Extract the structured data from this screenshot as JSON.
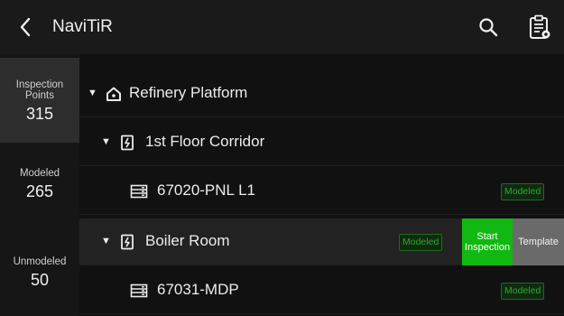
{
  "header": {
    "title": "NaviTiR",
    "back_icon": "chevron-left-icon",
    "search_icon": "search-icon",
    "report_icon": "clipboard-settings-icon"
  },
  "sidebar": {
    "stats": [
      {
        "label_line1": "Inspection",
        "label_line2": "Points",
        "value": "315",
        "active": true
      },
      {
        "label_line1": "Modeled",
        "label_line2": "",
        "value": "265",
        "active": false
      },
      {
        "label_line1": "Unmodeled",
        "label_line2": "",
        "value": "50",
        "active": false
      }
    ]
  },
  "tree": {
    "rows": [
      {
        "label": "Refinery Platform",
        "icon": "home-icon",
        "expanded": true,
        "badge": ""
      },
      {
        "label": "1st Floor Corridor",
        "icon": "electrical-panel-icon",
        "expanded": true,
        "badge": ""
      },
      {
        "label": "67020-PNL L1",
        "icon": "server-icon",
        "expanded": false,
        "badge": "Modeled"
      },
      {
        "label": "Boiler Room",
        "icon": "electrical-panel-icon",
        "expanded": true,
        "badge": "Modeled"
      },
      {
        "label": "67031-MDP",
        "icon": "server-icon",
        "expanded": false,
        "badge": "Modeled"
      }
    ],
    "actions": {
      "start_line1": "Start",
      "start_line2": "Inspection",
      "template": "Template"
    },
    "caret_glyph": "▼"
  },
  "colors": {
    "accent_green": "#11b811",
    "badge_green": "#2ea82e",
    "template_gray": "#6a6a6a"
  }
}
